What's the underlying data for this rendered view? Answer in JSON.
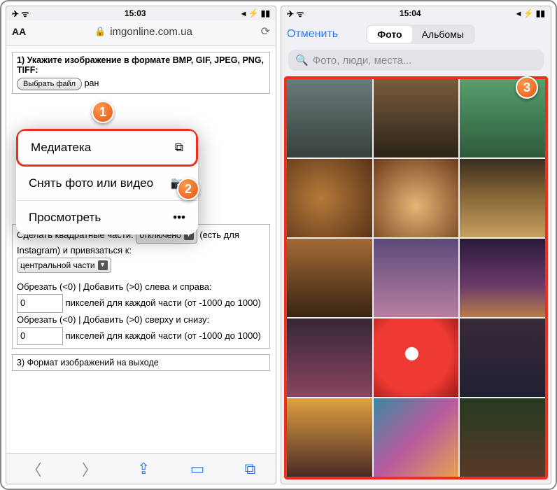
{
  "left": {
    "status": {
      "left": "✈ ᯤ",
      "time": "15:03",
      "right": "◂ ⚡ ▮▮"
    },
    "safari": {
      "aa": "AA",
      "lock": "🔒",
      "url": "imgonline.com.ua"
    },
    "step1": {
      "title": "1) Укажите изображение в формате BMP, GIF, JPEG, PNG, TIFF:",
      "file_btn": "Выбрать файл",
      "file_after": "ран"
    },
    "popup": {
      "media": "Медиатека",
      "capture": "Снять фото или видео",
      "browse": "Просмотреть"
    },
    "opts": {
      "square_pre": "Сделать квадратные части:",
      "square_sel": "отключено",
      "square_post": "(есть для Instagram) и привязаться к:",
      "anchor_sel": "центральной части",
      "crop_lr": "Обрезать (<0) | Добавить (>0) слева и справа:",
      "crop_tb": "Обрезать (<0) | Добавить (>0) сверху и снизу:",
      "val1": "0",
      "val2": "0",
      "px_note": "пикселей для каждой части (от -1000 до 1000)"
    },
    "step3": "3) Формат изображений на выходе"
  },
  "right": {
    "status": {
      "left": "✈ ᯤ",
      "time": "15:04",
      "right": "◂ ⚡ ▮▮"
    },
    "cancel": "Отменить",
    "seg_photo": "Фото",
    "seg_albums": "Альбомы",
    "search_ph": "Фото, люди, места..."
  },
  "callouts": {
    "c1": "1",
    "c2": "2",
    "c3": "3"
  }
}
